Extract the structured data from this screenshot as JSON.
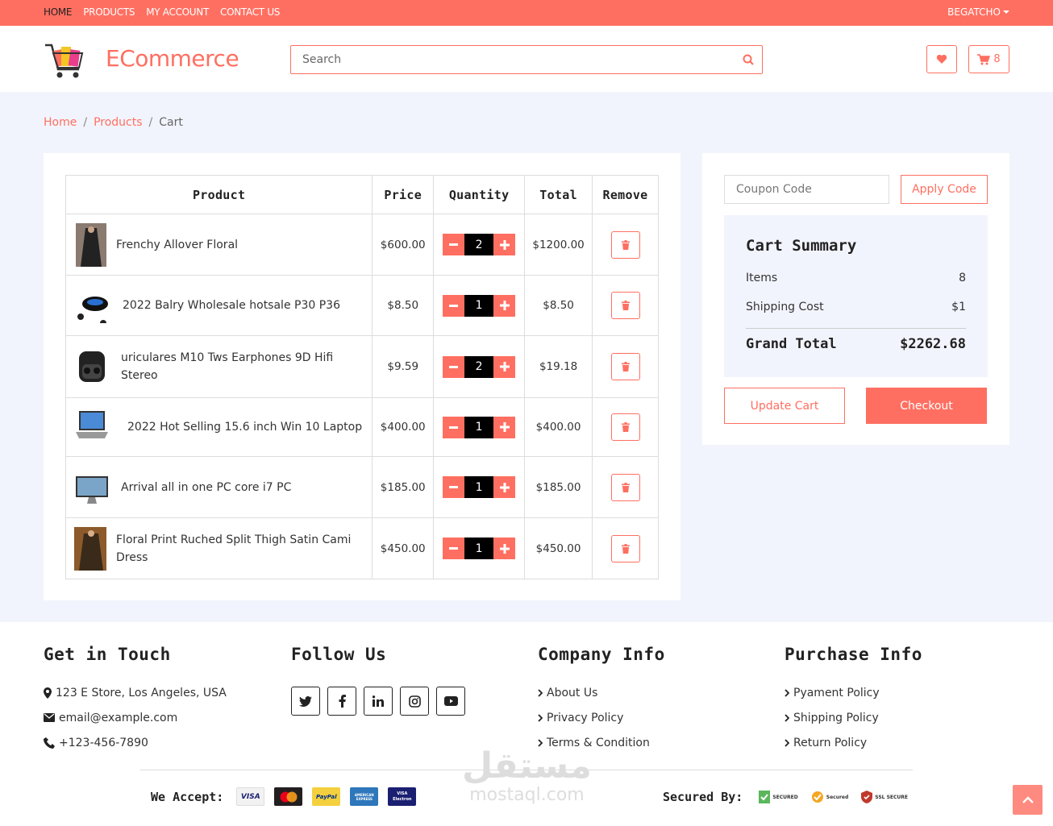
{
  "topbar": {
    "nav": [
      "HOME",
      "PRODUCTS",
      "MY ACCOUNT",
      "CONTACT US"
    ],
    "user": "BEGATCHO"
  },
  "header": {
    "brand": "ECommerce",
    "search_placeholder": "Search",
    "cart_count": "8"
  },
  "breadcrumb": {
    "home": "Home",
    "products": "Products",
    "current": "Cart",
    "separator": "/"
  },
  "cart": {
    "columns": [
      "Product",
      "Price",
      "Quantity",
      "Total",
      "Remove"
    ],
    "rows": [
      {
        "name": "Frenchy Allover Floral",
        "price": "$600.00",
        "qty": "2",
        "total": "$1200.00"
      },
      {
        "name": "2022 Balry Wholesale hotsale P30 P36",
        "price": "$8.50",
        "qty": "1",
        "total": "$8.50"
      },
      {
        "name": "uriculares M10 Tws Earphones 9D Hifi Stereo",
        "price": "$9.59",
        "qty": "2",
        "total": "$19.18"
      },
      {
        "name": "2022 Hot Selling 15.6 inch Win 10 Laptop",
        "price": "$400.00",
        "qty": "1",
        "total": "$400.00"
      },
      {
        "name": "Arrival all in one PC core i7 PC",
        "price": "$185.00",
        "qty": "1",
        "total": "$185.00"
      },
      {
        "name": "Floral Print Ruched Split Thigh Satin Cami Dress",
        "price": "$450.00",
        "qty": "1",
        "total": "$450.00"
      }
    ]
  },
  "summary": {
    "coupon_placeholder": "Coupon Code",
    "apply_label": "Apply Code",
    "title": "Cart Summary",
    "items_label": "Items",
    "items_value": "8",
    "shipping_label": "Shipping Cost",
    "shipping_value": "$1",
    "grand_label": "Grand Total",
    "grand_value": "$2262.68",
    "update_label": "Update Cart",
    "checkout_label": "Checkout"
  },
  "footer": {
    "touch": {
      "title": "Get in Touch",
      "address": "123 E Store, Los Angeles, USA",
      "email": "email@example.com",
      "phone": "+123-456-7890"
    },
    "follow": {
      "title": "Follow Us",
      "icons": [
        "twitter-icon",
        "facebook-icon",
        "linkedin-icon",
        "instagram-icon",
        "youtube-icon"
      ]
    },
    "company": {
      "title": "Company Info",
      "links": [
        "About Us",
        "Privacy Policy",
        "Terms & Condition"
      ]
    },
    "purchase": {
      "title": "Purchase Info",
      "links": [
        "Pyament Policy",
        "Shipping Policy",
        "Return Policy"
      ]
    },
    "accept_label": "We Accept:",
    "cards": [
      "VISA",
      "MasterCard",
      "PayPal",
      "AMERICAN EXPRESS",
      "VISA Electron"
    ],
    "secured_label": "Secured By:",
    "seals": [
      "SECURED",
      "Secured",
      "SSL SECURE"
    ],
    "watermark": {
      "arabic": "مستقل",
      "latin": "mostaql.com"
    }
  },
  "colors": {
    "accent": "#ff6f61",
    "page_bg": "#f2f4fd"
  }
}
